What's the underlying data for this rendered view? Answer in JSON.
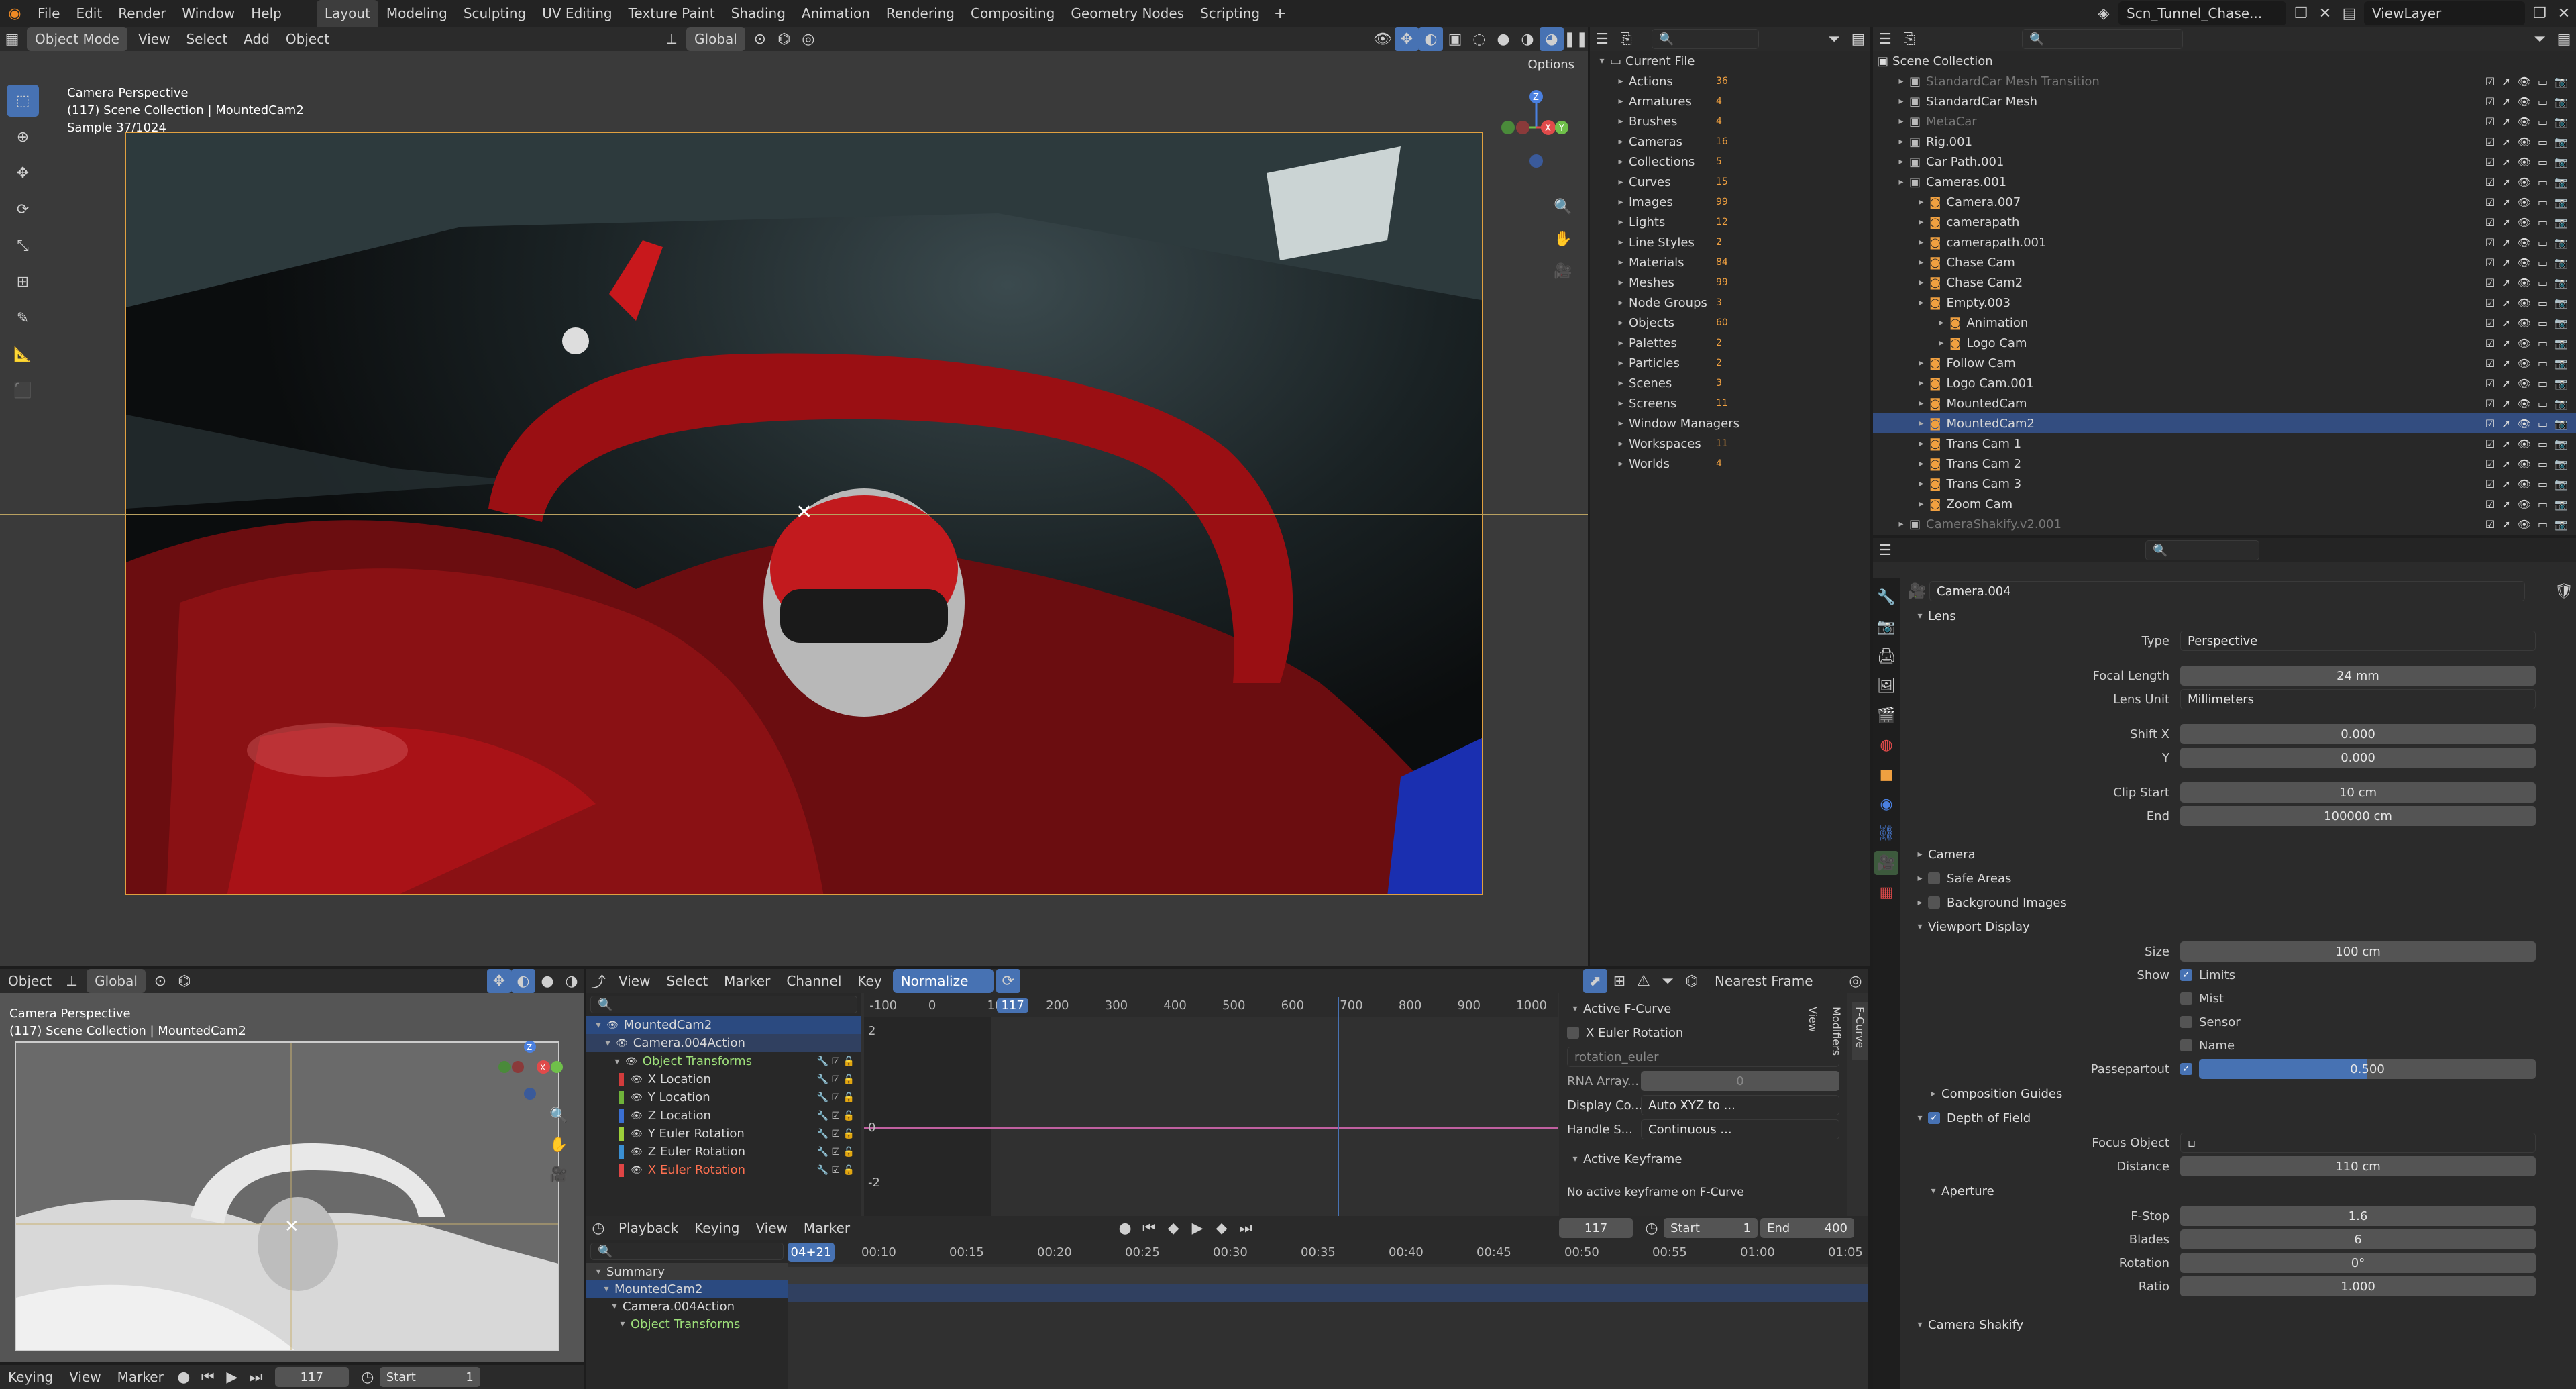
{
  "topbar": {
    "menus": [
      "File",
      "Edit",
      "Render",
      "Window",
      "Help"
    ],
    "workspaces": [
      "Layout",
      "Modeling",
      "Sculpting",
      "UV Editing",
      "Texture Paint",
      "Shading",
      "Animation",
      "Rendering",
      "Compositing",
      "Geometry Nodes",
      "Scripting"
    ],
    "active_workspace": "Layout",
    "scene": "Scn_Tunnel_Chase...",
    "view_layer": "ViewLayer"
  },
  "viewport": {
    "mode": "Object Mode",
    "menus": [
      "View",
      "Select",
      "Add",
      "Object"
    ],
    "transform": "Global",
    "options": "Options",
    "line1": "Camera Perspective",
    "line2": "(117) Scene Collection | MountedCam2",
    "line3": "Sample 37/1024"
  },
  "outliner_left": {
    "root": "Current File",
    "items": [
      {
        "name": "Actions",
        "count": "36"
      },
      {
        "name": "Armatures",
        "count": "4"
      },
      {
        "name": "Brushes",
        "count": "4"
      },
      {
        "name": "Cameras",
        "count": "16"
      },
      {
        "name": "Collections",
        "count": "5"
      },
      {
        "name": "Curves",
        "count": "15"
      },
      {
        "name": "Images",
        "count": "99"
      },
      {
        "name": "Lights",
        "count": "12"
      },
      {
        "name": "Line Styles",
        "count": "2"
      },
      {
        "name": "Materials",
        "count": "84"
      },
      {
        "name": "Meshes",
        "count": "99"
      },
      {
        "name": "Node Groups",
        "count": "3"
      },
      {
        "name": "Objects",
        "count": "60"
      },
      {
        "name": "Palettes",
        "count": "2"
      },
      {
        "name": "Particles",
        "count": "2"
      },
      {
        "name": "Scenes",
        "count": "3"
      },
      {
        "name": "Screens",
        "count": "11"
      },
      {
        "name": "Window Managers",
        "count": ""
      },
      {
        "name": "Workspaces",
        "count": "11"
      },
      {
        "name": "Worlds",
        "count": "4"
      }
    ]
  },
  "outliner_right": {
    "root": "Scene Collection",
    "items": [
      {
        "name": "StandardCar Mesh Transition",
        "dim": true,
        "indent": 1
      },
      {
        "name": "StandardCar Mesh",
        "dim": false,
        "indent": 1
      },
      {
        "name": "MetaCar",
        "dim": true,
        "indent": 1
      },
      {
        "name": "Rig.001",
        "dim": false,
        "indent": 1
      },
      {
        "name": "Car Path.001",
        "dim": false,
        "indent": 1
      },
      {
        "name": "Cameras.001",
        "dim": false,
        "indent": 1
      },
      {
        "name": "Camera.007",
        "dim": false,
        "indent": 2
      },
      {
        "name": "camerapath",
        "dim": false,
        "indent": 2
      },
      {
        "name": "camerapath.001",
        "dim": false,
        "indent": 2
      },
      {
        "name": "Chase Cam",
        "dim": false,
        "indent": 2
      },
      {
        "name": "Chase Cam2",
        "dim": false,
        "indent": 2
      },
      {
        "name": "Empty.003",
        "dim": false,
        "indent": 2
      },
      {
        "name": "Animation",
        "dim": false,
        "indent": 3
      },
      {
        "name": "Logo Cam",
        "dim": false,
        "indent": 3
      },
      {
        "name": "Follow Cam",
        "dim": false,
        "indent": 2
      },
      {
        "name": "Logo Cam.001",
        "dim": false,
        "indent": 2
      },
      {
        "name": "MountedCam",
        "dim": false,
        "indent": 2
      },
      {
        "name": "MountedCam2",
        "dim": false,
        "indent": 2,
        "selected": true
      },
      {
        "name": "Trans Cam 1",
        "dim": false,
        "indent": 2
      },
      {
        "name": "Trans Cam 2",
        "dim": false,
        "indent": 2
      },
      {
        "name": "Trans Cam 3",
        "dim": false,
        "indent": 2
      },
      {
        "name": "Zoom Cam",
        "dim": false,
        "indent": 2
      },
      {
        "name": "CameraShakify.v2.001",
        "dim": true,
        "indent": 1
      }
    ]
  },
  "properties": {
    "data_name": "Camera.004",
    "lens": {
      "title": "Lens",
      "type_label": "Type",
      "type": "Perspective",
      "focal_label": "Focal Length",
      "focal": "24 mm",
      "unit_label": "Lens Unit",
      "unit": "Millimeters",
      "shiftx_label": "Shift X",
      "shiftx": "0.000",
      "shifty_label": "Y",
      "shifty": "0.000",
      "clipstart_label": "Clip Start",
      "clipstart": "10 cm",
      "clipend_label": "End",
      "clipend": "100000 cm"
    },
    "sections": [
      "Camera",
      "Safe Areas",
      "Background Images"
    ],
    "viewport_display": {
      "title": "Viewport Display",
      "size_label": "Size",
      "size": "100 cm",
      "show_label": "Show",
      "show": [
        {
          "name": "Limits",
          "checked": true
        },
        {
          "name": "Mist",
          "checked": false
        },
        {
          "name": "Sensor",
          "checked": false
        },
        {
          "name": "Name",
          "checked": false
        }
      ],
      "passepartout_label": "Passepartout",
      "passepartout": "0.500",
      "passepartout_value": 0.5,
      "comp_guides": "Composition Guides"
    },
    "dof": {
      "title": "Depth of Field",
      "focus_label": "Focus Object",
      "distance_label": "Distance",
      "distance": "110 cm",
      "aperture": "Aperture",
      "fstop_label": "F-Stop",
      "fstop": "1.6",
      "blades_label": "Blades",
      "blades": "6",
      "rotation_label": "Rotation",
      "rotation": "0°",
      "ratio_label": "Ratio",
      "ratio": "1.000"
    },
    "shakify": "Camera Shakify"
  },
  "mini_viewport": {
    "menus": [
      "Object"
    ],
    "transform": "Global",
    "line1": "Camera Perspective",
    "line2": "(117) Scene Collection | MountedCam2"
  },
  "graph": {
    "menus": [
      "View",
      "Select",
      "Marker",
      "Channel",
      "Key"
    ],
    "normalize": "Normalize",
    "snap": "Nearest Frame",
    "ticks": [
      "-100",
      "0",
      "100",
      "117",
      "200",
      "300",
      "400",
      "500",
      "600",
      "700",
      "800",
      "900",
      "1000"
    ],
    "yticks": [
      "2",
      "0",
      "-2"
    ],
    "channels": [
      {
        "name": "MountedCam2",
        "level": 0,
        "sel": true
      },
      {
        "name": "Camera.004Action",
        "level": 1,
        "sel": true
      },
      {
        "name": "Object Transforms",
        "level": 2,
        "green": true
      },
      {
        "name": "X Location",
        "level": 3,
        "color": "#d23c3c"
      },
      {
        "name": "Y Location",
        "level": 3,
        "color": "#6fb33a"
      },
      {
        "name": "Z Location",
        "level": 3,
        "color": "#3a6fd2"
      },
      {
        "name": "Y Euler Rotation",
        "level": 3,
        "color": "#9ccf3a"
      },
      {
        "name": "Z Euler Rotation",
        "level": 3,
        "color": "#3a8fd2"
      },
      {
        "name": "X Euler Rotation",
        "level": 3,
        "color": "#e04545",
        "active": true
      }
    ],
    "active_fcurve": "Active F-Curve",
    "fcurve_name": "X Euler Rotation",
    "rna_path": "rotation_euler",
    "rna_array": "RNA Array...",
    "rna_index": "0",
    "display_color": "Display Co...",
    "display_val": "Auto XYZ to ...",
    "handle": "Handle S...",
    "handle_val": "Continuous ...",
    "active_keyframe": "Active Keyframe",
    "no_keyframe": "No active keyframe on F-Curve",
    "tabs": [
      "F-Curve",
      "Modifiers",
      "View"
    ]
  },
  "timeline": {
    "menus": [
      "Playback",
      "Keying",
      "View",
      "Marker"
    ],
    "frame": "117",
    "start_label": "Start",
    "start": "1",
    "end_label": "End",
    "end": "400",
    "current": "04+21",
    "ticks": [
      "00:10",
      "00:15",
      "00:20",
      "00:25",
      "00:30",
      "00:35",
      "00:40",
      "00:45",
      "00:50",
      "00:55",
      "01:00",
      "01:05"
    ],
    "rows": [
      "Summary",
      "MountedCam2",
      "Camera.004Action",
      "Object Transforms"
    ]
  },
  "bottom_left": {
    "menus": [
      "Keying",
      "View",
      "Marker"
    ],
    "frame": "117",
    "start_label": "Start",
    "start": "1"
  }
}
